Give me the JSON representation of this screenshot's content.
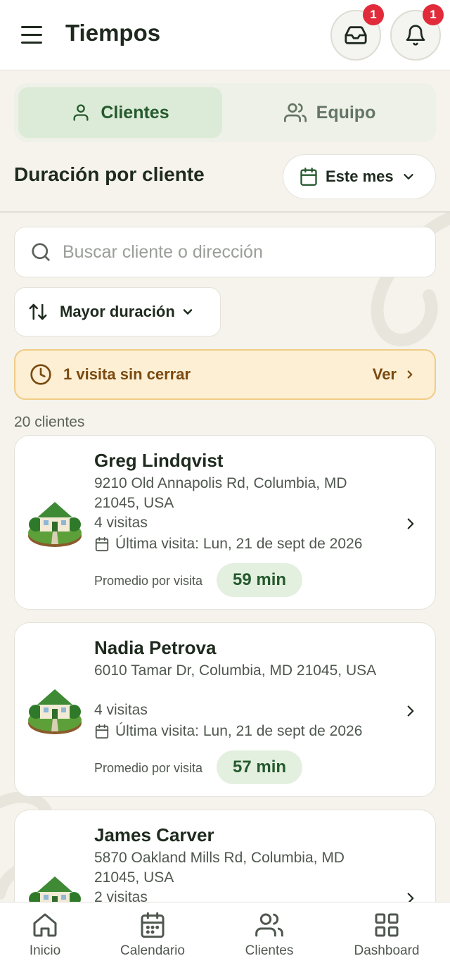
{
  "header": {
    "title": "Tiempos",
    "inbox_badge": "1",
    "notifications_badge": "1"
  },
  "tabs": [
    {
      "label": "Clientes",
      "active": true,
      "icon": "person-icon"
    },
    {
      "label": "Equipo",
      "active": false,
      "icon": "team-icon"
    }
  ],
  "section": {
    "title": "Duración por cliente",
    "period_label": "Este mes"
  },
  "search": {
    "placeholder": "Buscar cliente o dirección",
    "value": ""
  },
  "sort": {
    "label": "Mayor duración"
  },
  "alert": {
    "text": "1 visita sin cerrar",
    "action": "Ver"
  },
  "clients_count": "20 clientes",
  "clients": [
    {
      "name": "Greg Lindqvist",
      "address": "9210 Old Annapolis Rd, Columbia, MD 21045, USA",
      "visits": "4 visitas",
      "last_visit": "Última visita: Lun, 21 de sept de 2026",
      "avg_label": "Promedio por visita",
      "avg_value": "59 min"
    },
    {
      "name": "Nadia Petrova",
      "address": "6010 Tamar Dr, Columbia, MD 21045, USA",
      "visits": "4 visitas",
      "last_visit": "Última visita: Lun, 21 de sept de 2026",
      "avg_label": "Promedio por visita",
      "avg_value": "57 min"
    },
    {
      "name": "James Carver",
      "address": "5870 Oakland Mills Rd, Columbia, MD 21045, USA",
      "visits": "2 visitas"
    }
  ],
  "bottom_nav": [
    {
      "label": "Inicio",
      "icon": "home-icon"
    },
    {
      "label": "Calendario",
      "icon": "calendar-icon"
    },
    {
      "label": "Clientes",
      "icon": "clients-icon"
    },
    {
      "label": "Dashboard",
      "icon": "dashboard-icon"
    }
  ],
  "colors": {
    "accent": "#255a2e",
    "accent_bg": "#dcebd7",
    "alert_bg": "#fcefd4",
    "alert_text": "#7a4a10",
    "badge": "#e12b3a",
    "background": "#f5f3ec"
  }
}
